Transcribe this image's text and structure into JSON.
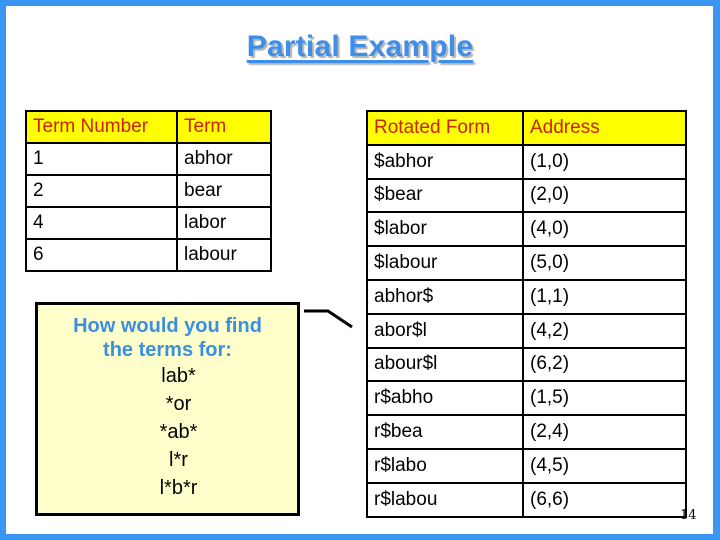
{
  "slide": {
    "title": "Partial Example",
    "page_number": "14",
    "colors": {
      "frame": "#3a96f0",
      "title": "#3f8fe8",
      "header_bg": "#ffff00",
      "header_text": "#cc2200",
      "callout_bg": "#ffffcc",
      "callout_question": "#3a8fe0"
    }
  },
  "term_table": {
    "headers": [
      "Term Number",
      "Term"
    ],
    "rows": [
      [
        "1",
        "abhor"
      ],
      [
        "2",
        "bear"
      ],
      [
        "4",
        "labor"
      ],
      [
        "6",
        "labour"
      ]
    ]
  },
  "rotation_table": {
    "headers": [
      "Rotated Form",
      "Address"
    ],
    "rows": [
      [
        "$abhor",
        "(1,0)"
      ],
      [
        "$bear",
        "(2,0)"
      ],
      [
        "$labor",
        "(4,0)"
      ],
      [
        "$labour",
        "(5,0)"
      ],
      [
        "abhor$",
        "(1,1)"
      ],
      [
        "abor$l",
        "(4,2)"
      ],
      [
        "abour$l",
        "(6,2)"
      ],
      [
        "r$abho",
        "(1,5)"
      ],
      [
        "r$bea",
        "(2,4)"
      ],
      [
        "r$labo",
        "(4,5)"
      ],
      [
        "r$labou",
        "(6,6)"
      ]
    ]
  },
  "callout": {
    "question_lines": [
      "How would you find",
      "the terms for:"
    ],
    "patterns": [
      "lab*",
      "*or",
      "*ab*",
      "l*r",
      "l*b*r"
    ]
  }
}
